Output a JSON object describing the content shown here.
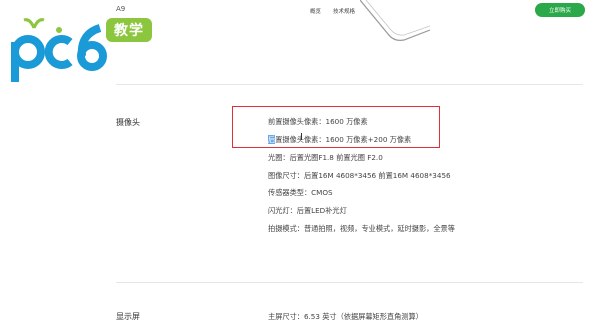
{
  "header": {
    "model": "A9",
    "nav": [
      "概览",
      "技术规格"
    ],
    "buy_button": "立即购买",
    "accent_color": "#2aa84a"
  },
  "watermark": {
    "logo_text": "pc6",
    "badge": "教学"
  },
  "camera": {
    "title": "摄像头",
    "specs": [
      "前置摄像头像素：1600 万像素",
      "后置摄像头像素：1600 万像素+200 万像素",
      "光圈：后置光圈F1.8  前置光圈 F2.0",
      "图像尺寸：后置16M 4608*3456  前置16M 4608*3456",
      "传感器类型：CMOS",
      "闪光灯：后置LED补光灯",
      "拍摄模式：普通拍照，视频，专业模式，延时摄影，全景等"
    ],
    "rear_first_char": "后",
    "rear_rest": "置摄像头像素：1600 万像素+200 万像素"
  },
  "display": {
    "title": "显示屏",
    "specs": [
      "主屏尺寸：6.53 英寸（依据屏幕矩形直角测算）"
    ]
  }
}
